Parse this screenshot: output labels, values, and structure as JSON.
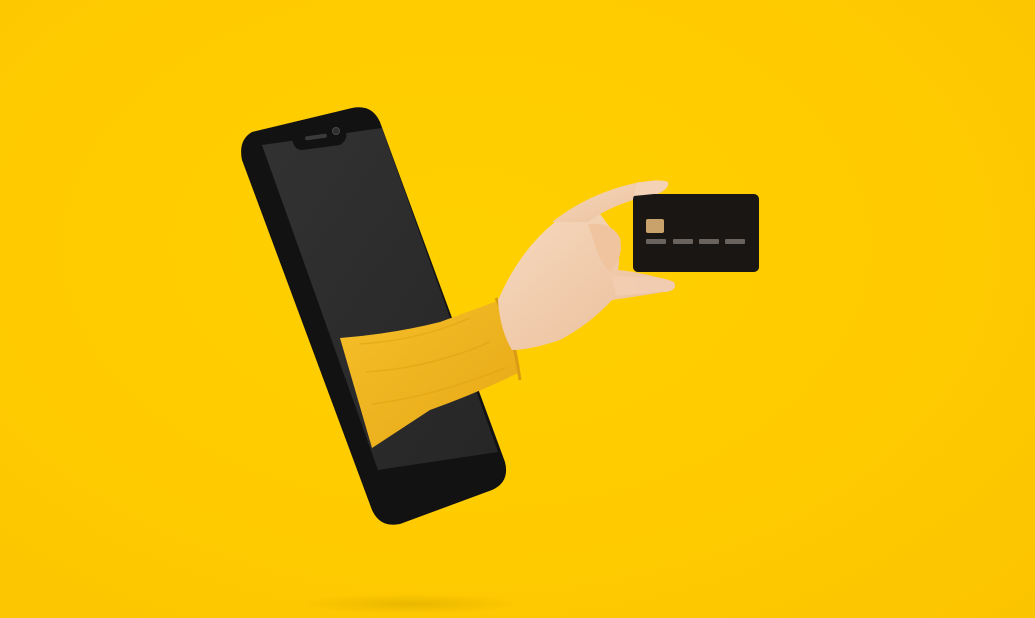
{
  "scene": {
    "description_colors": {
      "background": "#ffcc00",
      "phone_body": "#141414",
      "phone_screen": "#2b2b2b",
      "sweater": "#f2b51f",
      "skin": "#f0c9a8",
      "card": "#1a1614",
      "card_chip": "#c9a26b"
    },
    "icons": {
      "phone": "smartphone-icon",
      "card": "credit-card-icon"
    }
  }
}
